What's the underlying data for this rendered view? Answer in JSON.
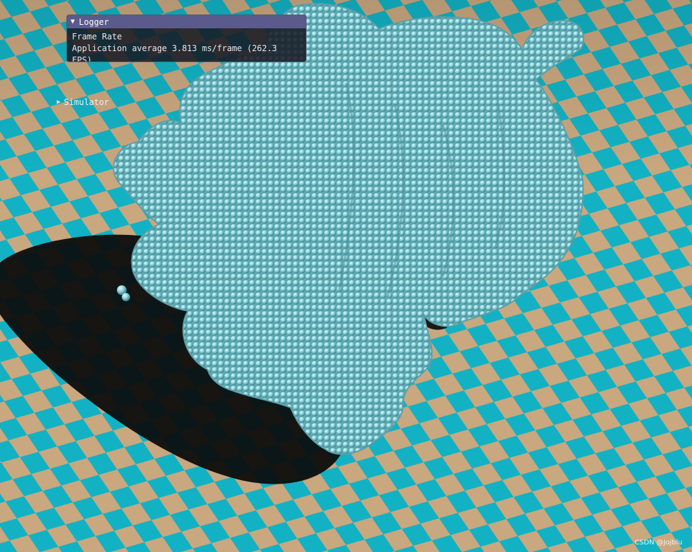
{
  "logger": {
    "title": "Logger",
    "lines": [
      "Frame Rate",
      "Application average 3.813 ms/frame (262.3 FPS)"
    ],
    "expanded": true
  },
  "simulator": {
    "title": "Simulator",
    "expanded": false
  },
  "watermark": "CSDN @Jojblu",
  "icons": {
    "expanded": "triangle-down",
    "collapsed": "triangle-right"
  },
  "colors": {
    "floor_teal": "#12b2c4",
    "floor_tan": "#c9a77f",
    "particle": "#8ed9e0",
    "particle_highlight": "#dff8fa",
    "particle_shadow": "#3d7f8a",
    "shadow": "#0a0a0a",
    "titlebar": "#5b5a8c"
  }
}
